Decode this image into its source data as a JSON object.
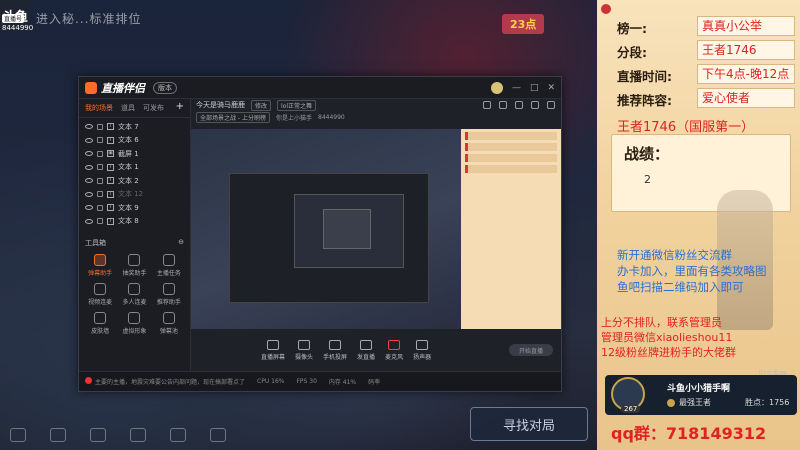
{
  "game": {
    "logo": "斗鱼",
    "badge": "直播号",
    "room_id": "8444990",
    "top_text": "进入秘...标准排位",
    "corner_badge": "23点",
    "find_match": "寻找对局"
  },
  "app": {
    "name": "直播伴侣",
    "version": "版本",
    "title_icons": [
      "avatar",
      "minimize-icon",
      "maximize-icon",
      "close-icon"
    ],
    "tabs": [
      "我的场景",
      "道具",
      "可发布"
    ],
    "layers": [
      {
        "name": "文本 7",
        "dim": false
      },
      {
        "name": "文本 6",
        "dim": false
      },
      {
        "name": "截屏 1",
        "dim": false
      },
      {
        "name": "文本 1",
        "dim": false
      },
      {
        "name": "文本 2",
        "dim": false
      },
      {
        "name": "文本 12",
        "dim": true
      },
      {
        "name": "文本 9",
        "dim": false
      },
      {
        "name": "文本 8",
        "dim": false
      }
    ],
    "tools_title": "工具箱",
    "tools": [
      {
        "label": "弹幕助手",
        "hot": true
      },
      {
        "label": "抽奖助手",
        "hot": false
      },
      {
        "label": "主播任务",
        "hot": false
      },
      {
        "label": "视频连麦",
        "hot": false
      },
      {
        "label": "多人连麦",
        "hot": false
      },
      {
        "label": "推荐助手",
        "hot": false
      },
      {
        "label": "皮肤墙",
        "hot": false
      },
      {
        "label": "虚拟形象",
        "hot": false
      },
      {
        "label": "弹幕池",
        "hot": false
      }
    ],
    "scene_title": "今天是骑马鹿鹿",
    "scene_chip1": "修改",
    "scene_chip2": "lol正常之舞",
    "scene_line2": "全部场景之战 - 上分刷榜",
    "scene_line2b": "你是上小猫手",
    "scene_id": "8444990",
    "controls": [
      "直播屏幕",
      "摄像头",
      "手机投屏",
      "发直播",
      "麦克风",
      "扬声器"
    ],
    "live_button": "开始直播",
    "status_text": "主要的主播，地震灾难要公告内部问题，现在搞部署点了",
    "status_items": [
      "CPU 16%",
      "FPS 30",
      "内存 41%",
      "码率"
    ]
  },
  "panel": {
    "rows": [
      {
        "label": "榜一:",
        "value": "真真小公举"
      },
      {
        "label": "分段:",
        "value": "王者1746"
      },
      {
        "label": "直播时间:",
        "value": "下午4点-晚12点"
      },
      {
        "label": "推荐阵容:",
        "value": "爱心使者"
      }
    ],
    "hero_rank": "王者1746（国服第一）",
    "record_title": "战绩：",
    "record_value": "2",
    "blue_lines": [
      "新开通微信粉丝交流群",
      "办卡加入，里面有各类攻略图",
      "鱼吧扫描二维码加入即可"
    ],
    "red_lines": [
      "上分不排队，联系管理员",
      "管理员微信xiaolieshou11",
      "12级粉丝牌进粉手的大佬群"
    ],
    "anchor": {
      "name": "斗鱼小小猎手啊",
      "level": "267",
      "rank": "最强王者",
      "win_label": "胜点：",
      "win_value": "1756",
      "tag": "时空裂痕"
    },
    "qq": "qq群：718149312"
  }
}
